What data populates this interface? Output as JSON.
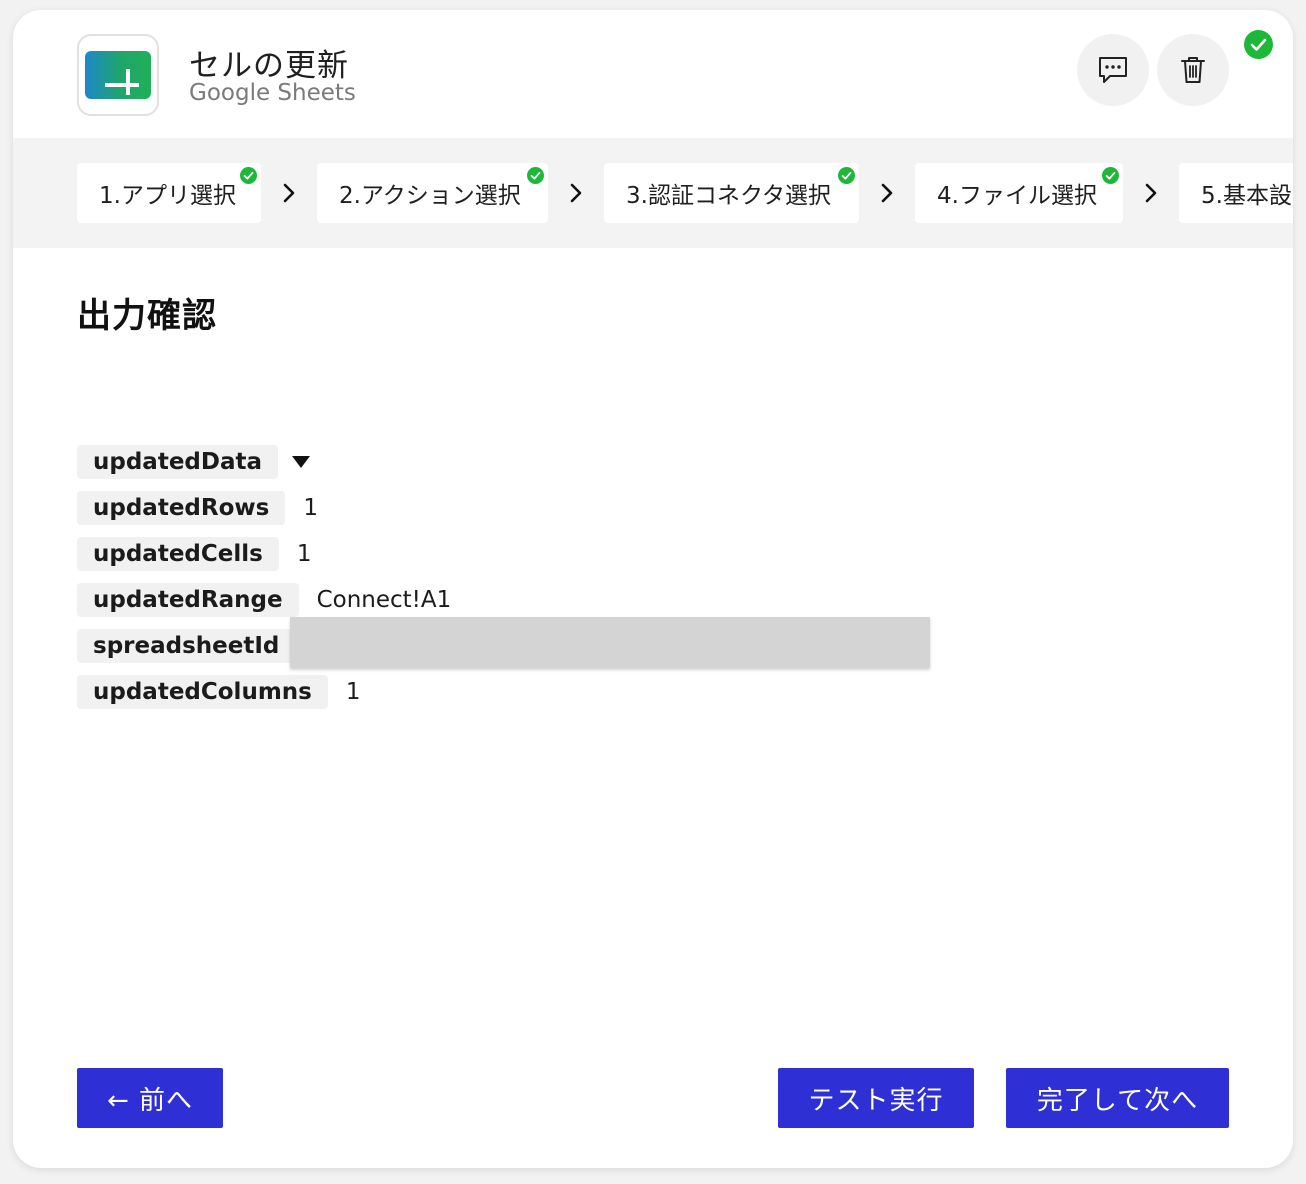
{
  "header": {
    "title": "セルの更新",
    "subtitle": "Google Sheets",
    "app_icon": "google-sheets-icon",
    "comment_icon": "comment-icon",
    "trash_icon": "trash-icon",
    "status_icon": "check-circle-icon"
  },
  "steps": [
    {
      "label": "1.アプリ選択",
      "done": true
    },
    {
      "label": "2.アクション選択",
      "done": true
    },
    {
      "label": "3.認証コネクタ選択",
      "done": true
    },
    {
      "label": "4.ファイル選択",
      "done": true
    },
    {
      "label": "5.基本設",
      "done": false
    }
  ],
  "main": {
    "section_title": "出力確認",
    "outputs": [
      {
        "key": "updatedData",
        "value": ""
      },
      {
        "key": "updatedRows",
        "value": "1"
      },
      {
        "key": "updatedCells",
        "value": "1"
      },
      {
        "key": "updatedRange",
        "value": "Connect!A1"
      },
      {
        "key": "spreadsheetId",
        "value": ""
      },
      {
        "key": "updatedColumns",
        "value": "1"
      }
    ]
  },
  "footer": {
    "back_label": "← 前へ",
    "test_label": "テスト実行",
    "next_label": "完了して次へ"
  },
  "colors": {
    "accent": "#2f2fd6",
    "success": "#1db83a",
    "sheets_green": "#1ea362"
  }
}
